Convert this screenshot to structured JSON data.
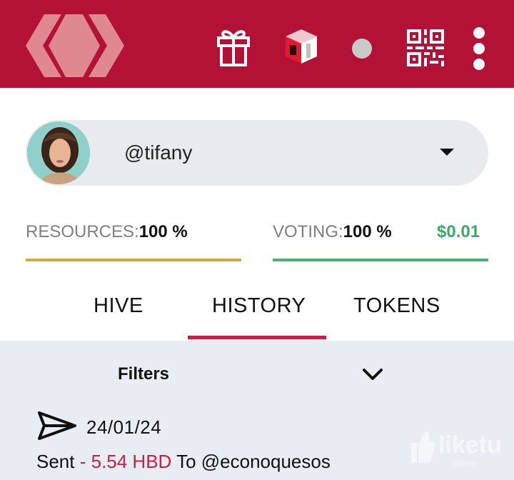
{
  "header": {
    "logo_icon": "hive-logo-icon",
    "icons": [
      "gift-icon",
      "keychain-icon",
      "status-dot-icon",
      "qr-code-icon",
      "more-vertical-icon"
    ],
    "brand_color": "#b31236",
    "status_dot_color": "#c9c9c9"
  },
  "account": {
    "username": "@tifany",
    "avatar_icon": "user-avatar",
    "dropdown_icon": "caret-down-icon"
  },
  "stats": {
    "resources_label": "RESOURCES:",
    "resources_value": "100 %",
    "resources_level": 1.0,
    "resources_color": "#d4aa3a",
    "voting_label": "VOTING:",
    "voting_value": "100 %",
    "voting_level": 1.0,
    "voting_color": "#4bb06f",
    "vote_value": "$0.01"
  },
  "tabs": [
    {
      "label": "HIVE"
    },
    {
      "label": "HISTORY",
      "active": true
    },
    {
      "label": "TOKENS"
    }
  ],
  "history": {
    "filters_label": "Filters",
    "filters_icon": "chevron-down-icon",
    "transactions": [
      {
        "icon": "send-icon",
        "date": "24/01/24",
        "type": "Sent",
        "separator": " - ",
        "amount": "5.54 HBD",
        "direction": " To ",
        "counterparty": "@econoquesos"
      }
    ]
  },
  "watermark": {
    "text": "liketu",
    "user": "@tifany"
  }
}
